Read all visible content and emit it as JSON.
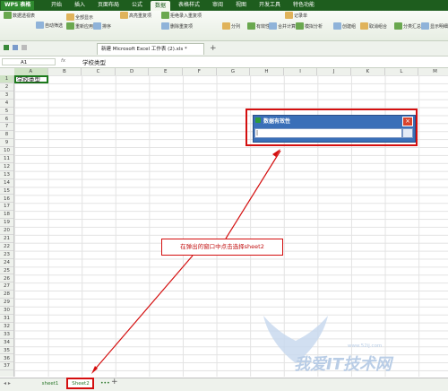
{
  "app": {
    "name": "WPS 表格"
  },
  "menu": [
    "开始",
    "插入",
    "页面布局",
    "公式",
    "数据",
    "表格样式",
    "审阅",
    "视图",
    "开发工具",
    "特色功能"
  ],
  "menu_active": "数据",
  "ribbon": {
    "items": [
      "数据透视表",
      "自动筛选",
      "全部显示",
      "重新应用",
      "排序",
      "高亮重复项",
      "拒绝录入重复项",
      "删除重复项",
      "分列",
      "有效性",
      "合并计算",
      "记录单",
      "模拟分析",
      "创建组",
      "取消组合",
      "分类汇总",
      "显示明细数据"
    ]
  },
  "file_tab": "新建 Microsoft Excel 工作表 (2).xls *",
  "formula_bar": {
    "name_box": "A1",
    "fx": "fx",
    "content": "学校类型"
  },
  "columns": [
    "A",
    "B",
    "C",
    "D",
    "E",
    "F",
    "G",
    "H",
    "I",
    "J",
    "K",
    "L",
    "M"
  ],
  "rows": [
    "1",
    "2",
    "3",
    "4",
    "5",
    "6",
    "7",
    "8",
    "9",
    "10",
    "11",
    "12",
    "13",
    "14",
    "15",
    "16",
    "17",
    "18",
    "19",
    "20",
    "21",
    "22",
    "23",
    "24",
    "25",
    "26",
    "27",
    "28",
    "29",
    "30",
    "31",
    "32",
    "33",
    "34",
    "35",
    "36",
    "37"
  ],
  "cell_a1": "学校类型",
  "dialog": {
    "title": "数据有效性",
    "input_value": "|"
  },
  "annotation": "在弹出的窗口中点击选择sheet2",
  "sheets": [
    "sheet1",
    "Sheet2"
  ],
  "watermark": "我爱IT技术网",
  "watermark_url": "www.52ij.com",
  "colors": {
    "accent": "#1e5d1e",
    "annotation": "#d40f0f",
    "dialog": "#3a6fb8"
  }
}
